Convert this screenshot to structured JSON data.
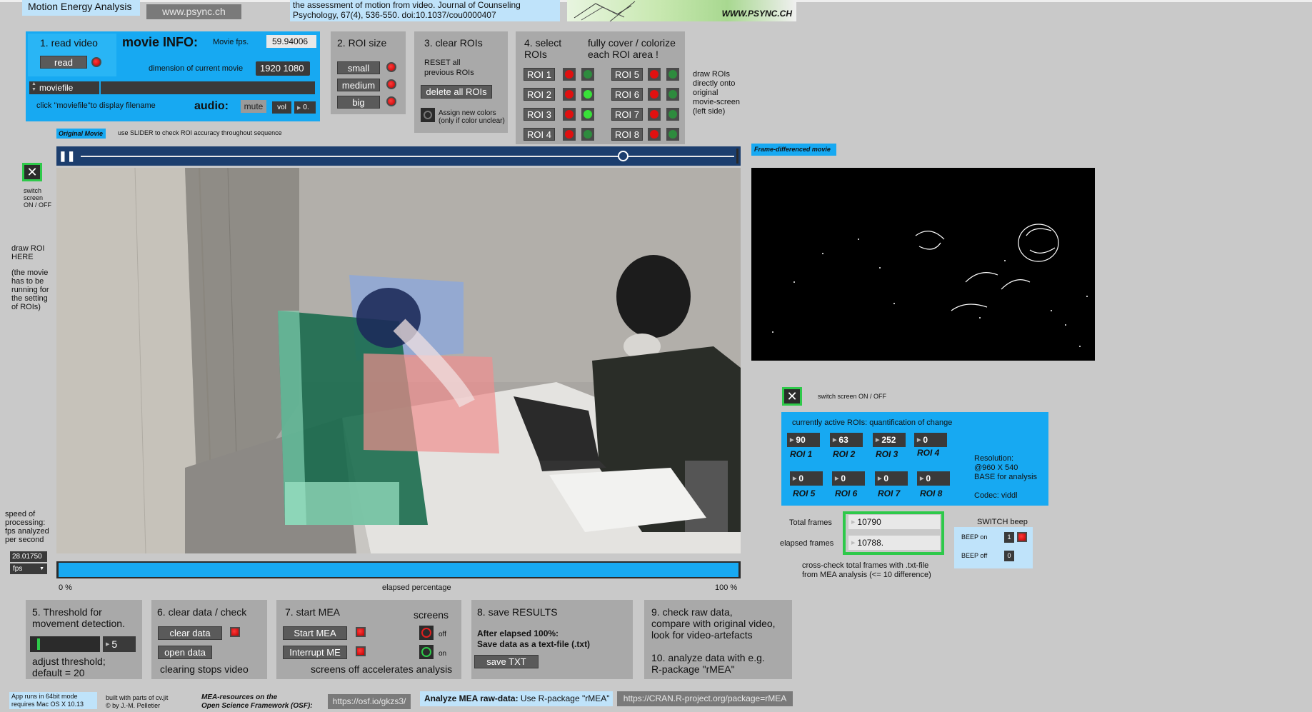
{
  "header": {
    "app_title": "Motion Energy Analysis",
    "website": "www.psync.ch",
    "citation_line1": "the assessment of motion from video. Journal of Counseling",
    "citation_line2": "Psychology, 67(4), 536-550. doi:10.1037/cou0000407",
    "logo_text": "WWW.PSYNC.CH"
  },
  "read_video": {
    "title": "1. read video",
    "read_button": "read",
    "movie_info_title": "movie INFO:",
    "fps_label": "Movie fps.",
    "fps_value": "59.94006",
    "dimension_label": "dimension of current movie",
    "dimension_value": "1920 1080",
    "file_menu": "moviefile",
    "file_hint": "click \"moviefile\"to display  filename",
    "audio_label": "audio:",
    "mute_button": "mute",
    "vol_label": "vol",
    "vol_value": "0."
  },
  "roi_size": {
    "title": "2. ROI size",
    "small": "small",
    "medium": "medium",
    "big": "big"
  },
  "clear_rois": {
    "title": "3. clear ROIs",
    "reset_line1": "RESET all",
    "reset_line2": "previous ROIs",
    "delete_button": "delete all ROIs",
    "assign_line1": "Assign new colors",
    "assign_line2": "(only if color unclear)"
  },
  "select_rois": {
    "title_line1": "4. select",
    "title_line2": "ROIs",
    "cover_line1": "fully cover / colorize",
    "cover_line2": "each ROI area !",
    "rois_left": [
      "ROI 1",
      "ROI 2",
      "ROI 3",
      "ROI 4"
    ],
    "rois_right": [
      "ROI 5",
      "ROI 6",
      "ROI 7",
      "ROI 8"
    ],
    "side_note_1": "draw ROIs",
    "side_note_2": "directly onto",
    "side_note_3": "original",
    "side_note_4": "movie-screen",
    "side_note_5": "(left side)"
  },
  "original_movie": {
    "tag": "Original Movie",
    "slider_hint": "use SLIDER to check ROI accuracy throughout sequence",
    "switch_line1": "switch",
    "switch_line2": "screen",
    "switch_line3": "ON / OFF",
    "draw_note_1": "draw ROI",
    "draw_note_2": "HERE",
    "draw_note_3": "(the movie",
    "draw_note_4": "has to be",
    "draw_note_5": "running for",
    "draw_note_6": "the setting",
    "draw_note_7": "of ROIs)",
    "speed_line1": "speed of",
    "speed_line2": "processing:",
    "speed_line3": "fps analyzed",
    "speed_line4": "per second",
    "speed_value": "28.01750",
    "speed_unit": "fps",
    "playback_position": 0.83
  },
  "progress": {
    "start_label": "0 %",
    "middle_label": "elapsed percentage",
    "end_label": "100 %",
    "percent": 100
  },
  "frame_diff": {
    "tag": "Frame-differenced movie",
    "switch_label": "switch screen ON / OFF"
  },
  "quantification": {
    "title": "currently active ROIs: quantification of change",
    "values_top": [
      "90",
      "63",
      "252",
      "0"
    ],
    "labels_top": [
      "ROI 1",
      "ROI 2",
      "ROI 3",
      "ROI 4"
    ],
    "values_bottom": [
      "0",
      "0",
      "0",
      "0"
    ],
    "labels_bottom": [
      "ROI 5",
      "ROI 6",
      "ROI 7",
      "ROI 8"
    ],
    "resolution_label": "Resolution:",
    "resolution_value": "@960 X 540",
    "resolution_note": "BASE for analysis",
    "codec": "Codec: viddl"
  },
  "frames": {
    "total_label": "Total frames",
    "total_value": "10790",
    "elapsed_label": "elapsed frames",
    "elapsed_value": "10788.",
    "note_line1": "cross-check total frames with .txt-file",
    "note_line2": "from MEA analysis (<= 10 difference)"
  },
  "beep": {
    "title": "SWITCH beep",
    "on_label": "BEEP  on",
    "on_value": "1",
    "off_label": "BEEP  off",
    "off_value": "0"
  },
  "threshold": {
    "title_line1": "5. Threshold for",
    "title_line2": "movement detection.",
    "value": "5",
    "note_line1": "adjust threshold;",
    "note_line2": "default = 20"
  },
  "clear_data": {
    "title": "6. clear data / check",
    "clear_button": "clear data",
    "open_button": "open data",
    "note": "clearing stops video"
  },
  "start_mea": {
    "title": "7. start MEA",
    "screens_label": "screens",
    "start_button": "Start MEA",
    "interrupt_button": "Interrupt ME",
    "off_label": "off",
    "on_label": "on",
    "note": "screens off accelerates analysis"
  },
  "save_results": {
    "title": "8. save RESULTS",
    "line1": "After elapsed 100%:",
    "line2": "Save data as a text-file (.txt)",
    "save_button": "save TXT"
  },
  "check_raw": {
    "line1": "9. check raw data,",
    "line2": "compare with original video,",
    "line3": "look for video-artefacts",
    "line4": "10. analyze data with e.g.",
    "line5": "R-package \"rMEA\""
  },
  "footer": {
    "app_line1": "App runs in 64bit  mode",
    "app_line2": "requires Mac OS X 10.13",
    "built_line1": "built with parts of cv.jit",
    "built_line2": "© by J.-M. Pelletier",
    "osf_line1": "MEA-resources on the",
    "osf_line2": "Open Science Framework (OSF):",
    "osf_link": "https://osf.io/gkzs3/",
    "rmea_bold": "Analyze MEA raw-data:",
    "rmea_text": " Use R-package \"rMEA\"",
    "cran_link": "https://CRAN.R-project.org/package=rMEA"
  },
  "colors": {
    "accent_blue": "#17a9f2",
    "panel_gray": "#a9a9a9",
    "background": "#c9c9c9",
    "highlight_green": "#2ec94a"
  }
}
